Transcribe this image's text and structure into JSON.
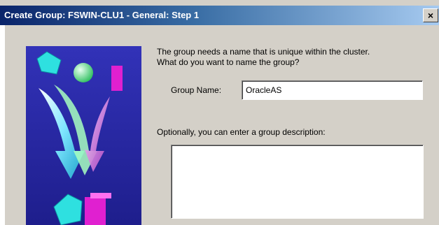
{
  "window": {
    "title": "Create Group: FSWIN-CLU1 - General:  Step 1",
    "close_glyph": "×",
    "titlebar_colors": [
      "#0a246a",
      "#3a6ea5",
      "#a6caf0"
    ]
  },
  "content": {
    "prompt": "The group needs a name that is unique within the cluster. What do you want to name the group?",
    "group_name_label": "Group Name:",
    "group_name_value": "OracleAS",
    "description_label": "Optionally, you can enter a group description:",
    "description_value": ""
  },
  "art": {
    "icon": "wizard-banner",
    "background": "#2a2aa0"
  }
}
